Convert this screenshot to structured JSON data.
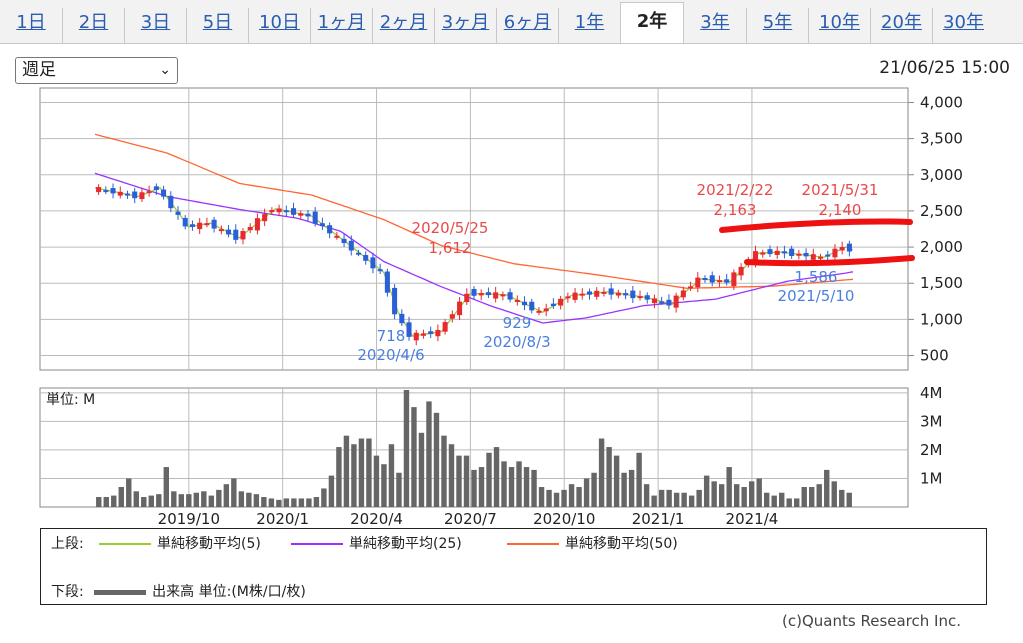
{
  "tabs": [
    {
      "label": "1日"
    },
    {
      "label": "2日"
    },
    {
      "label": "3日"
    },
    {
      "label": "5日"
    },
    {
      "label": "10日"
    },
    {
      "label": "1ヶ月"
    },
    {
      "label": "2ヶ月"
    },
    {
      "label": "3ヶ月"
    },
    {
      "label": "6ヶ月"
    },
    {
      "label": "1年"
    },
    {
      "label": "2年",
      "active": true
    },
    {
      "label": "3年"
    },
    {
      "label": "5年"
    },
    {
      "label": "10年"
    },
    {
      "label": "20年"
    },
    {
      "label": "30年"
    }
  ],
  "period_select": {
    "value": "週足"
  },
  "timestamp": "21/06/25 15:00",
  "colors": {
    "up": "#e8292f",
    "down": "#2a5fd8",
    "ma5": "#9acd32",
    "ma25": "#9933ff",
    "ma50": "#ff6633",
    "volume": "#666666",
    "high_label": "#e84a4a",
    "low_label": "#4a7fe0",
    "marker": "#ee1111"
  },
  "chart_data": [
    {
      "type": "candlestick",
      "y_ticks": [
        4000,
        3500,
        3000,
        2500,
        2000,
        1500,
        1000,
        500
      ],
      "y_tick_labels": [
        "4,000",
        "3,500",
        "3,000",
        "2,500",
        "2,000",
        "1,500",
        "1,000",
        "500"
      ],
      "ylim": [
        300,
        4200
      ],
      "x_tick_labels": [
        "2019/10",
        "2020/1",
        "2020/4",
        "2020/7",
        "2020/10",
        "2021/1",
        "2021/4"
      ],
      "x_tick_weeks": [
        13,
        26,
        39,
        52,
        65,
        78,
        91
      ],
      "weeks": 105,
      "ma_legend": [
        "単純移動平均(5)",
        "単純移動平均(25)",
        "単純移動平均(50)"
      ],
      "price_path": [
        [
          0,
          2820
        ],
        [
          6,
          2700
        ],
        [
          9,
          2820
        ],
        [
          13,
          2280
        ],
        [
          16,
          2330
        ],
        [
          20,
          2130
        ],
        [
          25,
          2530
        ],
        [
          30,
          2430
        ],
        [
          35,
          2050
        ],
        [
          40,
          1650
        ],
        [
          42,
          1100
        ],
        [
          44,
          770
        ],
        [
          48,
          830
        ],
        [
          52,
          1360
        ],
        [
          57,
          1340
        ],
        [
          62,
          1100
        ],
        [
          66,
          1330
        ],
        [
          71,
          1380
        ],
        [
          76,
          1310
        ],
        [
          80,
          1210
        ],
        [
          82,
          1400
        ],
        [
          84,
          1560
        ],
        [
          88,
          1520
        ],
        [
          92,
          1920
        ],
        [
          95,
          1930
        ],
        [
          101,
          1860
        ],
        [
          104,
          2000
        ],
        [
          108,
          1850
        ],
        [
          112,
          1760
        ],
        [
          116,
          1890
        ]
      ],
      "ma50_path": [
        [
          0,
          3560
        ],
        [
          10,
          3300
        ],
        [
          20,
          2880
        ],
        [
          30,
          2720
        ],
        [
          40,
          2380
        ],
        [
          48,
          2020
        ],
        [
          58,
          1770
        ],
        [
          70,
          1610
        ],
        [
          82,
          1430
        ],
        [
          94,
          1460
        ],
        [
          108,
          1580
        ],
        [
          116,
          1650
        ]
      ],
      "ma25_path": [
        [
          0,
          3020
        ],
        [
          10,
          2700
        ],
        [
          20,
          2520
        ],
        [
          28,
          2400
        ],
        [
          34,
          2220
        ],
        [
          40,
          1800
        ],
        [
          48,
          1450
        ],
        [
          55,
          1180
        ],
        [
          62,
          950
        ],
        [
          68,
          1020
        ],
        [
          76,
          1190
        ],
        [
          86,
          1280
        ],
        [
          96,
          1530
        ],
        [
          104,
          1640
        ],
        [
          112,
          1790
        ],
        [
          116,
          1830
        ]
      ],
      "annotations": [
        {
          "date": "2021/2/22",
          "value": "2,163",
          "kind": "high"
        },
        {
          "date": "2021/5/31",
          "value": "2,140",
          "kind": "high"
        },
        {
          "date": "2020/5/25",
          "value": "1,612",
          "kind": "high"
        },
        {
          "date": "2020/4/6",
          "value": "718",
          "kind": "low"
        },
        {
          "date": "2020/8/3",
          "value": "929",
          "kind": "low"
        },
        {
          "date": "2021/5/10",
          "value": "1,586",
          "kind": "low"
        }
      ]
    },
    {
      "type": "bar",
      "unit_label": "単位: M",
      "y_tick_labels": [
        "4M",
        "3M",
        "2M",
        "1M"
      ],
      "y_ticks": [
        4,
        3,
        2,
        1
      ],
      "ylim": [
        0,
        4.1
      ],
      "values": [
        0.35,
        0.35,
        0.4,
        0.7,
        1.0,
        0.55,
        0.35,
        0.4,
        0.45,
        1.4,
        0.55,
        0.45,
        0.45,
        0.5,
        0.55,
        0.4,
        0.6,
        0.8,
        1.0,
        0.55,
        0.5,
        0.45,
        0.35,
        0.3,
        0.25,
        0.3,
        0.3,
        0.3,
        0.3,
        0.35,
        0.65,
        1.1,
        2.1,
        2.5,
        2.2,
        2.4,
        2.4,
        1.8,
        1.5,
        2.2,
        1.2,
        4.1,
        3.5,
        2.6,
        3.7,
        3.3,
        2.5,
        2.2,
        1.8,
        1.8,
        1.3,
        1.4,
        1.9,
        2.1,
        1.6,
        1.4,
        1.6,
        1.4,
        1.3,
        0.7,
        0.6,
        0.5,
        0.6,
        0.8,
        0.7,
        1.0,
        1.2,
        2.4,
        2.1,
        1.8,
        1.2,
        1.3,
        1.9,
        0.8,
        0.4,
        0.6,
        0.6,
        0.5,
        0.5,
        0.4,
        0.6,
        1.1,
        0.9,
        0.8,
        1.4,
        0.8,
        0.7,
        0.9,
        1.0,
        0.5,
        0.4,
        0.5,
        0.3,
        0.3,
        0.7,
        0.7,
        0.8,
        1.3,
        0.9,
        0.6,
        0.5
      ]
    }
  ],
  "legend": {
    "upper_label": "上段:",
    "lower_label": "下段:",
    "volume_label": "出来高 単位:(M株/口/枚)"
  },
  "copyright": "(c)Quants Research Inc."
}
